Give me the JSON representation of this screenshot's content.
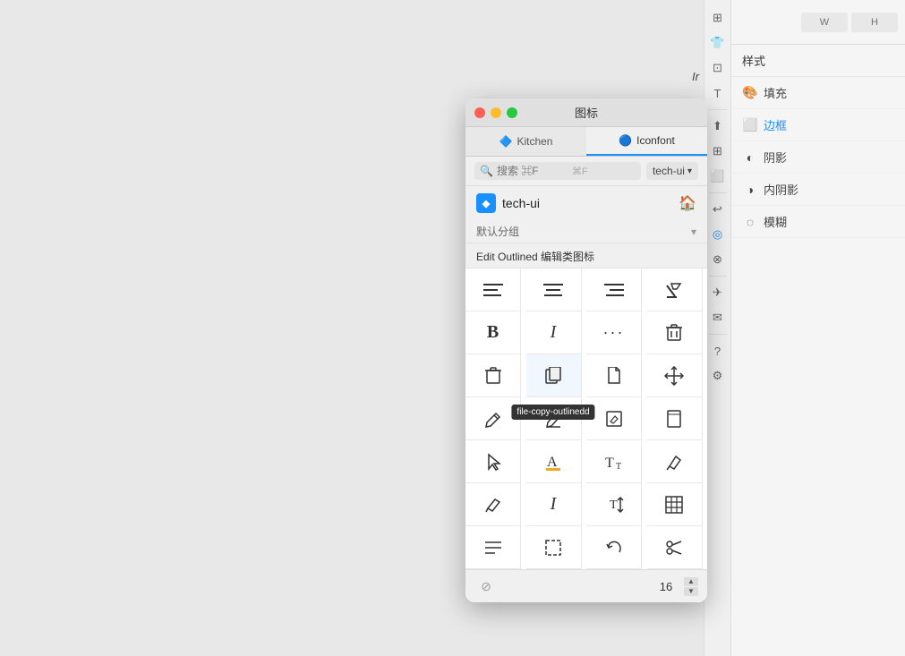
{
  "window": {
    "title": "图标",
    "traffic_lights": [
      "close",
      "minimize",
      "maximize"
    ]
  },
  "tabs": [
    {
      "id": "kitchen",
      "label": "Kitchen",
      "icon": "🔷",
      "active": false
    },
    {
      "id": "iconfont",
      "label": "Iconfont",
      "icon": "🔵",
      "active": true
    }
  ],
  "search": {
    "placeholder": "搜索 ⌘F",
    "shortcut": "⌘F",
    "dropdown_value": "tech-ui"
  },
  "library": {
    "brand_icon": "◆",
    "brand_name": "tech-ui"
  },
  "group": {
    "name": "默认分组",
    "collapsed": false
  },
  "section": {
    "title": "Edit Outlined 编辑类图标"
  },
  "icons": [
    {
      "symbol": "≡",
      "name": "align-left"
    },
    {
      "symbol": "≡",
      "name": "align-center"
    },
    {
      "symbol": "≡",
      "name": "align-right"
    },
    {
      "symbol": "⊘",
      "name": "format-clear"
    },
    {
      "symbol": "𝐁",
      "name": "bold"
    },
    {
      "symbol": "𝐼",
      "name": "italic"
    },
    {
      "symbol": "···",
      "name": "more"
    },
    {
      "symbol": "🗑",
      "name": "delete"
    },
    {
      "symbol": "🗑",
      "name": "delete-outlined"
    },
    {
      "symbol": "⧉",
      "name": "file-copy-outlined"
    },
    {
      "symbol": "📄",
      "name": "file-outlined"
    },
    {
      "symbol": "✛",
      "name": "move"
    },
    {
      "symbol": "✏",
      "name": "edit"
    },
    {
      "symbol": "✒",
      "name": "edit-outlined"
    },
    {
      "symbol": "📝",
      "name": "edit-square"
    },
    {
      "symbol": "📚",
      "name": "book"
    },
    {
      "symbol": "👆",
      "name": "cursor"
    },
    {
      "symbol": "A",
      "name": "font-colors"
    },
    {
      "symbol": "Tₜ",
      "name": "font-size"
    },
    {
      "symbol": "✒",
      "name": "highlight"
    },
    {
      "symbol": "✏",
      "name": "pencil"
    },
    {
      "symbol": "𝐼",
      "name": "italic-outlined"
    },
    {
      "symbol": "T↕",
      "name": "line-height"
    },
    {
      "symbol": "⊞",
      "name": "table"
    },
    {
      "symbol": "☰",
      "name": "list"
    },
    {
      "symbol": "⬚",
      "name": "selection"
    },
    {
      "symbol": "↺",
      "name": "undo"
    },
    {
      "symbol": "✂",
      "name": "scissor"
    }
  ],
  "tooltip": {
    "visible": true,
    "text": "file-copy-outlinedd",
    "target_index": 9
  },
  "footer": {
    "size_value": "16",
    "reset_icon": "⊘"
  },
  "right_panel": {
    "size_w_placeholder": "W",
    "size_h_placeholder": "H",
    "style_header": "样式",
    "style_items": [
      {
        "label": "填充",
        "icon": "🎨",
        "active": false
      },
      {
        "label": "边框",
        "icon": "⬜",
        "active": true
      },
      {
        "label": "阴影",
        "icon": "◐",
        "active": false
      },
      {
        "label": "内阴影",
        "icon": "◑",
        "active": false
      },
      {
        "label": "模糊",
        "icon": "◌",
        "active": false
      }
    ]
  },
  "side_icons": [
    {
      "symbol": "⊞",
      "name": "layout-icon"
    },
    {
      "symbol": "👕",
      "name": "component-icon"
    },
    {
      "symbol": "⊡",
      "name": "grid-icon"
    },
    {
      "symbol": "T",
      "name": "text-icon"
    },
    {
      "symbol": "···",
      "name": "more-icon"
    },
    {
      "symbol": "⬆",
      "name": "export-icon"
    },
    {
      "symbol": "⊞",
      "name": "group-icon"
    },
    {
      "symbol": "⬜",
      "name": "frame-icon"
    },
    {
      "symbol": "↩",
      "name": "undo-icon"
    },
    {
      "symbol": "◎",
      "name": "lock-icon"
    },
    {
      "symbol": "⊗",
      "name": "mask-icon"
    },
    {
      "symbol": "✈",
      "name": "plugin-icon"
    },
    {
      "symbol": "✉",
      "name": "mail-icon"
    },
    {
      "symbol": "?",
      "name": "help-icon"
    },
    {
      "symbol": "⚙",
      "name": "settings-icon"
    }
  ],
  "ir_text": "Ir"
}
